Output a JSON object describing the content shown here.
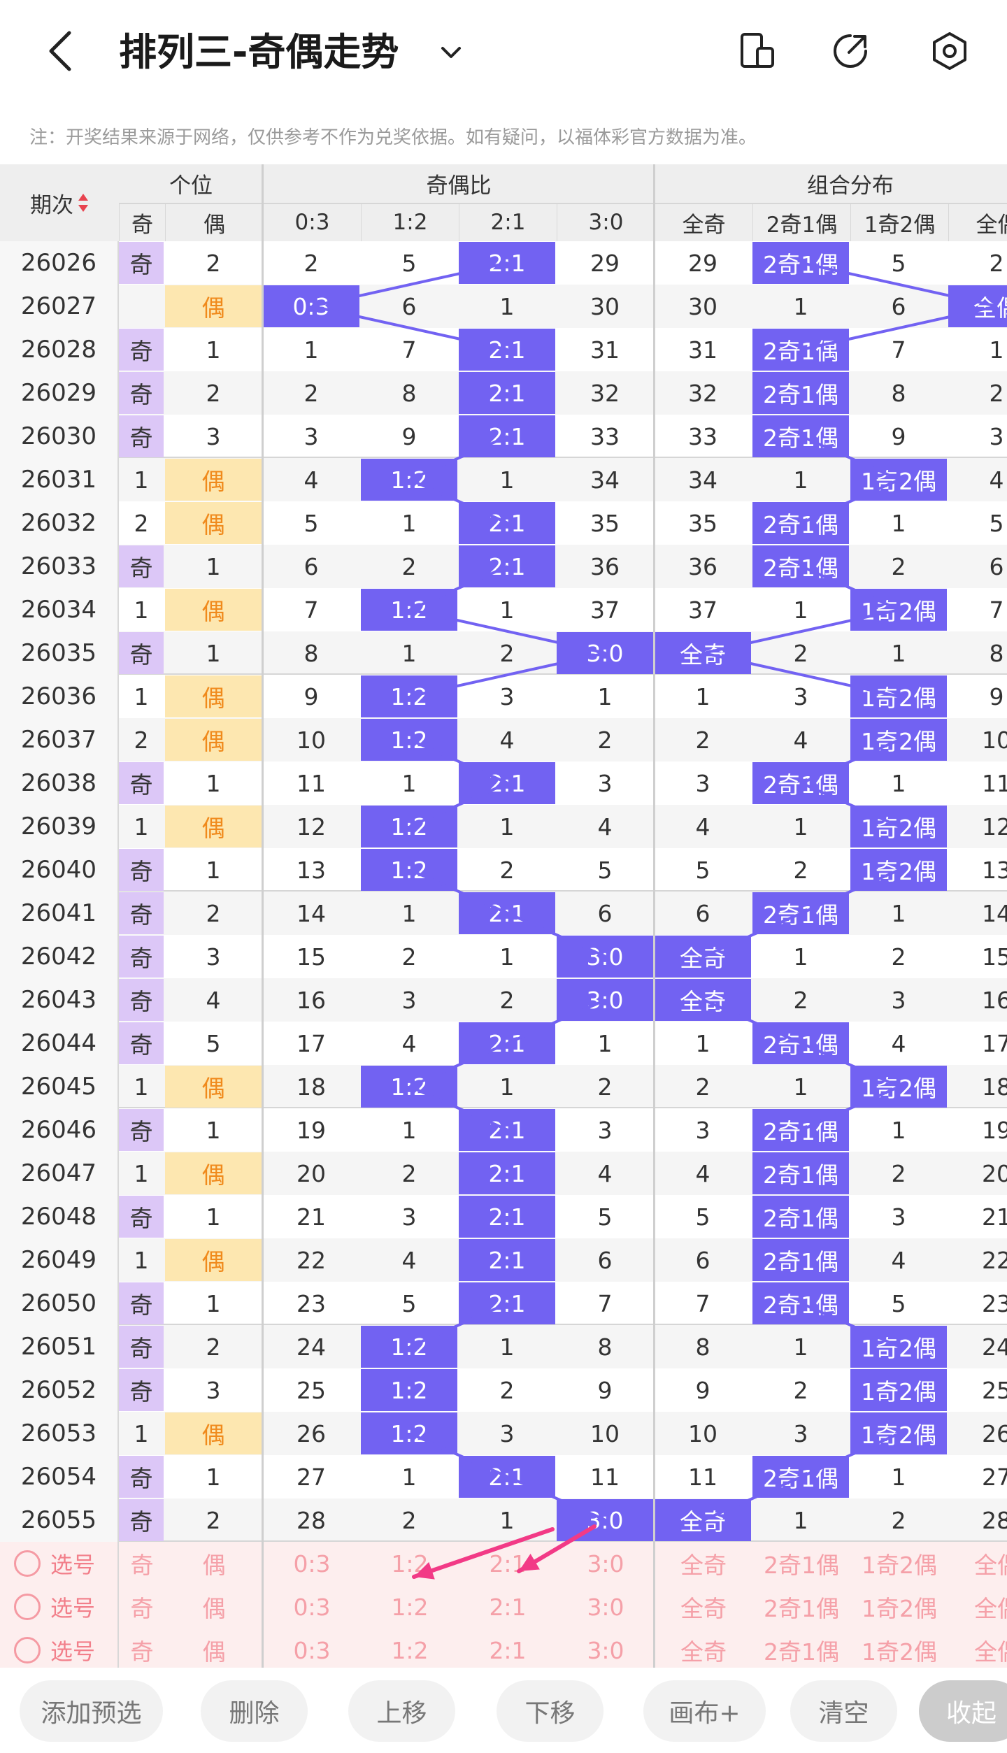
{
  "header": {
    "title": "排列三-奇偶走势",
    "note": "注：开奖结果来源于网络，仅供参考不作为兑奖依据。如有疑问，以福体彩官方数据为准。"
  },
  "table": {
    "issue_header": "期次",
    "groups": [
      {
        "label": "个位"
      },
      {
        "label": "奇偶比"
      },
      {
        "label": "组合分布"
      }
    ],
    "subheaders": [
      "奇",
      "偶",
      "0:3",
      "1:2",
      "2:1",
      "3:0",
      "全奇",
      "2奇1偶",
      "1奇2偶",
      "全偶"
    ],
    "rows": [
      {
        "issue": "26026",
        "cells": [
          "奇",
          "2",
          "2",
          "5",
          "2:1",
          "29",
          "29",
          "2奇1偶",
          "5",
          "2"
        ]
      },
      {
        "issue": "26027",
        "cells": [
          "",
          "偶",
          "0:3",
          "6",
          "1",
          "30",
          "30",
          "1",
          "6",
          "全偶"
        ]
      },
      {
        "issue": "26028",
        "cells": [
          "奇",
          "1",
          "1",
          "7",
          "2:1",
          "31",
          "31",
          "2奇1偶",
          "7",
          "1"
        ]
      },
      {
        "issue": "26029",
        "cells": [
          "奇",
          "2",
          "2",
          "8",
          "2:1",
          "32",
          "32",
          "2奇1偶",
          "8",
          "2"
        ]
      },
      {
        "issue": "26030",
        "cells": [
          "奇",
          "3",
          "3",
          "9",
          "2:1",
          "33",
          "33",
          "2奇1偶",
          "9",
          "3"
        ]
      },
      {
        "issue": "26031",
        "cells": [
          "1",
          "偶",
          "4",
          "1:2",
          "1",
          "34",
          "34",
          "1",
          "1奇2偶",
          "4"
        ]
      },
      {
        "issue": "26032",
        "cells": [
          "2",
          "偶",
          "5",
          "1",
          "2:1",
          "35",
          "35",
          "2奇1偶",
          "1",
          "5"
        ]
      },
      {
        "issue": "26033",
        "cells": [
          "奇",
          "1",
          "6",
          "2",
          "2:1",
          "36",
          "36",
          "2奇1偶",
          "2",
          "6"
        ]
      },
      {
        "issue": "26034",
        "cells": [
          "1",
          "偶",
          "7",
          "1:2",
          "1",
          "37",
          "37",
          "1",
          "1奇2偶",
          "7"
        ]
      },
      {
        "issue": "26035",
        "cells": [
          "奇",
          "1",
          "8",
          "1",
          "2",
          "3:0",
          "全奇",
          "2",
          "1",
          "8"
        ]
      },
      {
        "issue": "26036",
        "cells": [
          "1",
          "偶",
          "9",
          "1:2",
          "3",
          "1",
          "1",
          "3",
          "1奇2偶",
          "9"
        ]
      },
      {
        "issue": "26037",
        "cells": [
          "2",
          "偶",
          "10",
          "1:2",
          "4",
          "2",
          "2",
          "4",
          "1奇2偶",
          "10"
        ]
      },
      {
        "issue": "26038",
        "cells": [
          "奇",
          "1",
          "11",
          "1",
          "2:1",
          "3",
          "3",
          "2奇1偶",
          "1",
          "11"
        ]
      },
      {
        "issue": "26039",
        "cells": [
          "1",
          "偶",
          "12",
          "1:2",
          "1",
          "4",
          "4",
          "1",
          "1奇2偶",
          "12"
        ]
      },
      {
        "issue": "26040",
        "cells": [
          "奇",
          "1",
          "13",
          "1:2",
          "2",
          "5",
          "5",
          "2",
          "1奇2偶",
          "13"
        ]
      },
      {
        "issue": "26041",
        "cells": [
          "奇",
          "2",
          "14",
          "1",
          "2:1",
          "6",
          "6",
          "2奇1偶",
          "1",
          "14"
        ]
      },
      {
        "issue": "26042",
        "cells": [
          "奇",
          "3",
          "15",
          "2",
          "1",
          "3:0",
          "全奇",
          "1",
          "2",
          "15"
        ]
      },
      {
        "issue": "26043",
        "cells": [
          "奇",
          "4",
          "16",
          "3",
          "2",
          "3:0",
          "全奇",
          "2",
          "3",
          "16"
        ]
      },
      {
        "issue": "26044",
        "cells": [
          "奇",
          "5",
          "17",
          "4",
          "2:1",
          "1",
          "1",
          "2奇1偶",
          "4",
          "17"
        ]
      },
      {
        "issue": "26045",
        "cells": [
          "1",
          "偶",
          "18",
          "1:2",
          "1",
          "2",
          "2",
          "1",
          "1奇2偶",
          "18"
        ]
      },
      {
        "issue": "26046",
        "cells": [
          "奇",
          "1",
          "19",
          "1",
          "2:1",
          "3",
          "3",
          "2奇1偶",
          "1",
          "19"
        ]
      },
      {
        "issue": "26047",
        "cells": [
          "1",
          "偶",
          "20",
          "2",
          "2:1",
          "4",
          "4",
          "2奇1偶",
          "2",
          "20"
        ]
      },
      {
        "issue": "26048",
        "cells": [
          "奇",
          "1",
          "21",
          "3",
          "2:1",
          "5",
          "5",
          "2奇1偶",
          "3",
          "21"
        ]
      },
      {
        "issue": "26049",
        "cells": [
          "1",
          "偶",
          "22",
          "4",
          "2:1",
          "6",
          "6",
          "2奇1偶",
          "4",
          "22"
        ]
      },
      {
        "issue": "26050",
        "cells": [
          "奇",
          "1",
          "23",
          "5",
          "2:1",
          "7",
          "7",
          "2奇1偶",
          "5",
          "23"
        ]
      },
      {
        "issue": "26051",
        "cells": [
          "奇",
          "2",
          "24",
          "1:2",
          "1",
          "8",
          "8",
          "1",
          "1奇2偶",
          "24"
        ]
      },
      {
        "issue": "26052",
        "cells": [
          "奇",
          "3",
          "25",
          "1:2",
          "2",
          "9",
          "9",
          "2",
          "1奇2偶",
          "25"
        ]
      },
      {
        "issue": "26053",
        "cells": [
          "1",
          "偶",
          "26",
          "1:2",
          "3",
          "10",
          "10",
          "3",
          "1奇2偶",
          "26"
        ]
      },
      {
        "issue": "26054",
        "cells": [
          "奇",
          "1",
          "27",
          "1",
          "2:1",
          "11",
          "11",
          "2奇1偶",
          "1",
          "27"
        ]
      },
      {
        "issue": "26055",
        "cells": [
          "奇",
          "2",
          "28",
          "2",
          "1",
          "3:0",
          "全奇",
          "1",
          "2",
          "28"
        ]
      }
    ],
    "select_rows": [
      {
        "label": "选号",
        "cells": [
          "奇",
          "偶",
          "0:3",
          "1:2",
          "2:1",
          "3:0",
          "全奇",
          "2奇1偶",
          "1奇2偶",
          "全偶"
        ]
      },
      {
        "label": "选号",
        "cells": [
          "奇",
          "偶",
          "0:3",
          "1:2",
          "2:1",
          "3:0",
          "全奇",
          "2奇1偶",
          "1奇2偶",
          "全偶"
        ]
      },
      {
        "label": "选号",
        "cells": [
          "奇",
          "偶",
          "0:3",
          "1:2",
          "2:1",
          "3:0",
          "全奇",
          "2奇1偶",
          "1奇2偶",
          "全偶"
        ]
      }
    ]
  },
  "toolbar": {
    "add": "添加预选",
    "delete": "删除",
    "up": "上移",
    "down": "下移",
    "canvas": "画布+",
    "clear": "清空",
    "collapse": "收起"
  },
  "colors": {
    "hit": "#7262f2",
    "odd": "#dcc7f7",
    "even": "#fde7b0",
    "arrow": "#f23a86"
  }
}
